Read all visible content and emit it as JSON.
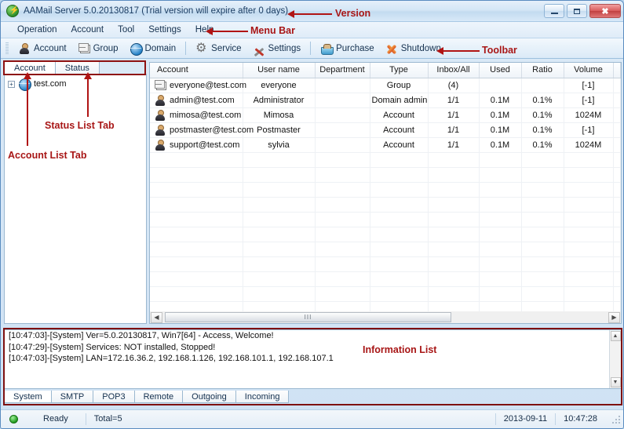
{
  "window": {
    "title": "AAMail Server 5.0.20130817 (Trial version will expire after 0 days)",
    "app_icon": "lightning-bolt-icon",
    "minimize_label": "Minimize",
    "maximize_label": "Maximize",
    "close_label": "✖"
  },
  "menubar": {
    "items": [
      {
        "label": "Operation"
      },
      {
        "label": "Account"
      },
      {
        "label": "Tool"
      },
      {
        "label": "Settings"
      },
      {
        "label": "Help"
      }
    ]
  },
  "toolbar": {
    "items": [
      {
        "label": "Account",
        "icon": "person-icon"
      },
      {
        "label": "Group",
        "icon": "group-envelope-icon"
      },
      {
        "label": "Domain",
        "icon": "globe-icon"
      },
      {
        "label": "Service",
        "icon": "gear-icon"
      },
      {
        "label": "Settings",
        "icon": "tools-icon"
      },
      {
        "label": "Purchase",
        "icon": "cart-icon"
      },
      {
        "label": "Shutdown",
        "icon": "x-cross-icon"
      }
    ]
  },
  "left_panel": {
    "tabs": [
      {
        "label": "Account",
        "selected": true
      },
      {
        "label": "Status",
        "selected": false
      }
    ],
    "tree": [
      {
        "label": "test.com",
        "icon": "globe-icon",
        "expander": "+"
      }
    ]
  },
  "account_list": {
    "columns": [
      "Account",
      "User name",
      "Department",
      "Type",
      "Inbox/All",
      "Used",
      "Ratio",
      "Volume"
    ],
    "rows": [
      {
        "icon": "group-envelope-icon",
        "account": "everyone@test.com",
        "user_name": "everyone",
        "department": "",
        "type": "Group",
        "inbox_all": "(4)",
        "used": "",
        "ratio": "",
        "volume": "[-1]"
      },
      {
        "icon": "person-icon",
        "account": "admin@test.com",
        "user_name": "Administrator",
        "department": "",
        "type": "Domain admin",
        "inbox_all": "1/1",
        "used": "0.1M",
        "ratio": "0.1%",
        "volume": "[-1]"
      },
      {
        "icon": "person-icon",
        "account": "mimosa@test.com",
        "user_name": "Mimosa",
        "department": "",
        "type": "Account",
        "inbox_all": "1/1",
        "used": "0.1M",
        "ratio": "0.1%",
        "volume": "1024M"
      },
      {
        "icon": "person-icon",
        "account": "postmaster@test.com",
        "user_name": "Postmaster",
        "department": "",
        "type": "Account",
        "inbox_all": "1/1",
        "used": "0.1M",
        "ratio": "0.1%",
        "volume": "[-1]"
      },
      {
        "icon": "person-icon",
        "account": "support@test.com",
        "user_name": "sylvia",
        "department": "",
        "type": "Account",
        "inbox_all": "1/1",
        "used": "0.1M",
        "ratio": "0.1%",
        "volume": "1024M"
      }
    ],
    "hscroll": {
      "left_arrow": "◀",
      "right_arrow": "▶",
      "thumb_grip": "III"
    }
  },
  "information_list": {
    "lines": [
      "[10:47:03]-[System] Ver=5.0.20130817, Win7[64] - Access, Welcome!",
      "[10:47:29]-[System] Services: NOT installed, Stopped!",
      "[10:47:03]-[System] LAN=172.16.36.2, 192.168.1.126, 192.168.101.1, 192.168.107.1"
    ],
    "vscroll": {
      "up_arrow": "▲",
      "down_arrow": "▼"
    }
  },
  "bottom_tabs": {
    "items": [
      {
        "label": "System",
        "selected": true
      },
      {
        "label": "SMTP",
        "selected": false
      },
      {
        "label": "POP3",
        "selected": false
      },
      {
        "label": "Remote",
        "selected": false
      },
      {
        "label": "Outgoing",
        "selected": false
      },
      {
        "label": "Incoming",
        "selected": false
      }
    ]
  },
  "status_bar": {
    "led": "status-green",
    "state": "Ready",
    "total": "Total=5",
    "date": "2013-09-11",
    "time": "10:47:28"
  },
  "annotations": {
    "version": "Version",
    "menu_bar": "Menu Bar",
    "toolbar": "Toolbar",
    "status_list_tab": "Status List Tab",
    "account_list_tab": "Account List Tab",
    "information_list": "Information List"
  },
  "colors": {
    "annotation_red": "#a81616",
    "frame_red": "#8e1111",
    "titlebar_blue": "#d4e6f6",
    "panel_border": "#9bb8d0",
    "close_button": "#c14141",
    "status_led_green": "#219b1e"
  }
}
